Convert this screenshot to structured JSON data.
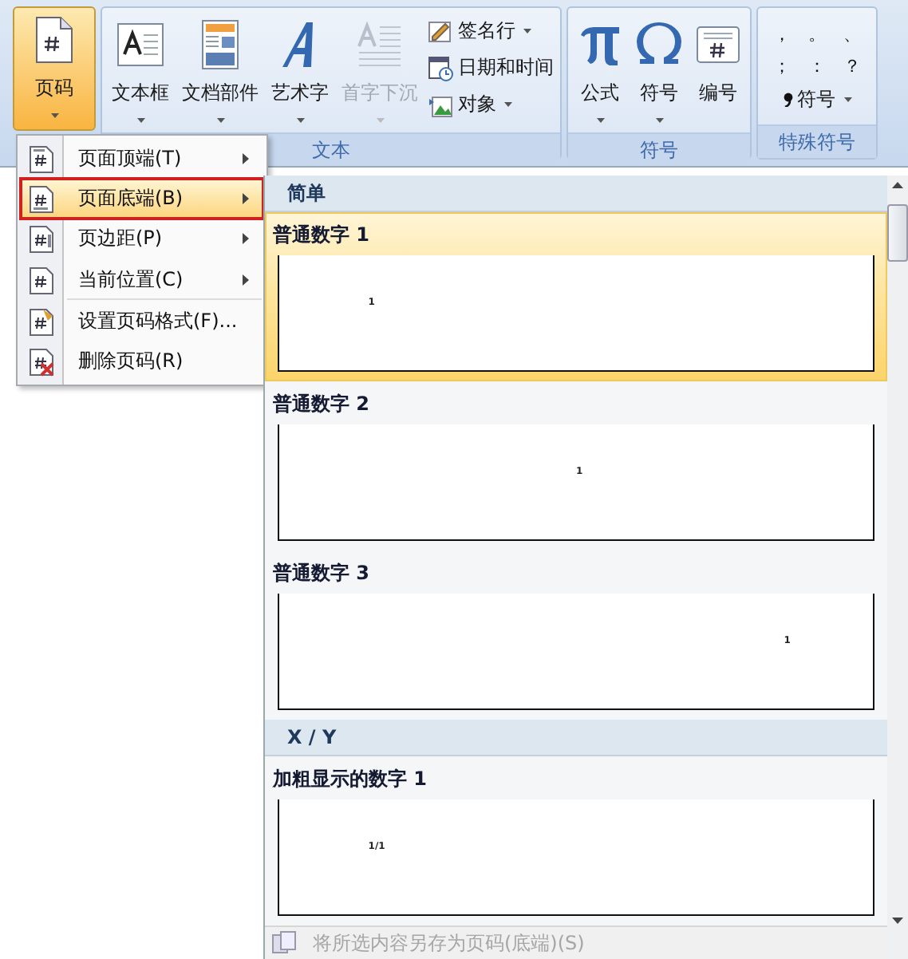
{
  "ribbon": {
    "page_number": {
      "label": "页码",
      "active": true,
      "dropdown": true
    },
    "groups": [
      {
        "label": "文本",
        "large": [
          {
            "label": "文本框",
            "disabled": false,
            "dropdown": true
          },
          {
            "label": "文档部件",
            "disabled": false,
            "dropdown": true
          },
          {
            "label": "艺术字",
            "disabled": false,
            "dropdown": true
          },
          {
            "label": "首字下沉",
            "disabled": true,
            "dropdown": true
          }
        ],
        "small": [
          {
            "label": "签名行",
            "dropdown": true
          },
          {
            "label": "日期和时间",
            "dropdown": false
          },
          {
            "label": "对象",
            "dropdown": true
          }
        ]
      },
      {
        "label": "符号",
        "large": [
          {
            "label": "公式",
            "disabled": false,
            "dropdown": true
          },
          {
            "label": "符号",
            "disabled": false,
            "dropdown": true
          },
          {
            "label": "编号",
            "disabled": false,
            "dropdown": false
          }
        ]
      }
    ],
    "special": {
      "label": "特殊符号",
      "symbols": [
        "，",
        "。",
        "、",
        "；",
        "：",
        "？"
      ],
      "menu": {
        "label": "符号",
        "dropdown": true
      }
    }
  },
  "menu": {
    "items": [
      {
        "label": "页面顶端(T)",
        "submenu": true,
        "selected": false,
        "marked": false
      },
      {
        "label": "页面底端(B)",
        "submenu": true,
        "selected": true,
        "marked": true
      },
      {
        "label": "页边距(P)",
        "submenu": true,
        "selected": false,
        "marked": false
      },
      {
        "label": "当前位置(C)",
        "submenu": true,
        "selected": false,
        "marked": false,
        "separator_after": true
      },
      {
        "label": "设置页码格式(F)...",
        "submenu": false,
        "selected": false,
        "marked": false
      },
      {
        "label": "删除页码(R)",
        "submenu": false,
        "selected": false,
        "marked": false
      }
    ]
  },
  "gallery": {
    "sections": [
      {
        "header": "简单",
        "items": [
          {
            "label": "普通数字 1",
            "selected": true,
            "preview": "1",
            "kind": "left"
          },
          {
            "label": "普通数字 2",
            "selected": false,
            "preview": "1",
            "kind": "center"
          },
          {
            "label": "普通数字 3",
            "selected": false,
            "preview": "1",
            "kind": "right"
          }
        ]
      },
      {
        "header": "X / Y",
        "items": [
          {
            "label": "加粗显示的数字 1",
            "selected": false,
            "preview": "1/1",
            "kind": "left"
          }
        ]
      }
    ],
    "footer": {
      "label": "将所选内容另存为页码(底端)(S)",
      "disabled": true
    }
  }
}
